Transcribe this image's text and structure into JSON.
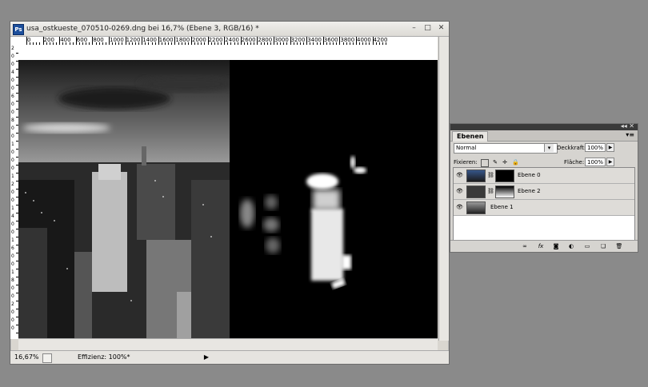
{
  "window": {
    "title": "usa_ostkueste_070510-0269.dng bei 16,7% (Ebene 3, RGB/16) *",
    "app_icon": "Ps",
    "minimize": "–",
    "maximize": "□",
    "close": "✕"
  },
  "ruler": {
    "top_labels": [
      "0",
      "200",
      "400",
      "600",
      "800",
      "1000",
      "1200",
      "1400",
      "1600",
      "1800",
      "2000",
      "2200",
      "2400",
      "2600",
      "2800",
      "3000",
      "3200",
      "3400",
      "3600",
      "3800",
      "4000",
      "4200"
    ],
    "left_labels": [
      "2",
      "0",
      "0",
      "4",
      "0",
      "0",
      "6",
      "0",
      "0",
      "8",
      "0",
      "0",
      "1",
      "0",
      "0",
      "0",
      "1",
      "2",
      "0",
      "0",
      "1",
      "4",
      "0",
      "0",
      "1",
      "6",
      "0",
      "0",
      "1",
      "8",
      "0",
      "0",
      "2",
      "0",
      "0",
      "0"
    ]
  },
  "status": {
    "zoom": "16,67%",
    "efficiency": "Effizienz: 100%*",
    "arrow": "▶"
  },
  "layers_panel": {
    "tab": "Ebenen",
    "collapse_icons": "◂◂ ✕",
    "menu_icon": "▾≡",
    "blend_mode": "Normal",
    "opacity_label": "Deckkraft:",
    "opacity_value": "100%",
    "lock_label": "Fixieren:",
    "fill_label": "Fläche:",
    "fill_value": "100%",
    "layers": [
      {
        "name": "Ebene 0"
      },
      {
        "name": "Ebene 2"
      },
      {
        "name": "Ebene 1"
      }
    ],
    "footer_icons": [
      "link-icon",
      "fx-icon",
      "mask-icon",
      "adjustment-icon",
      "group-icon",
      "new-layer-icon",
      "trash-icon"
    ]
  }
}
